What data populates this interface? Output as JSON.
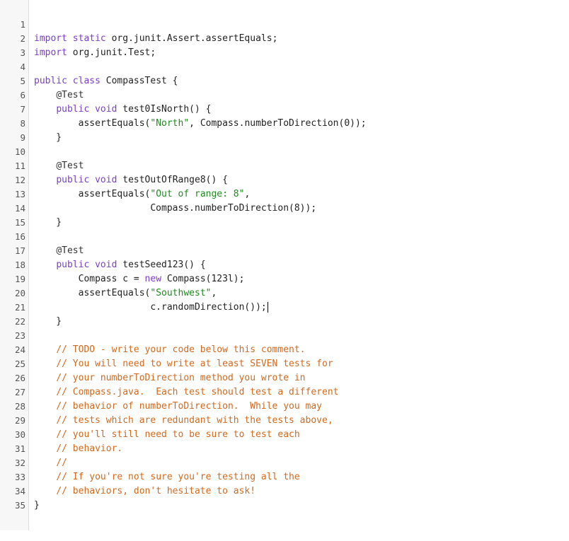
{
  "editor": {
    "line_numbers": [
      "1",
      "2",
      "3",
      "4",
      "5",
      "6",
      "7",
      "8",
      "9",
      "10",
      "11",
      "12",
      "13",
      "14",
      "15",
      "16",
      "17",
      "18",
      "19",
      "20",
      "21",
      "22",
      "23",
      "24",
      "25",
      "26",
      "27",
      "28",
      "29",
      "30",
      "31",
      "32",
      "33",
      "34",
      "35"
    ],
    "lines": [
      [
        "import",
        " ",
        "static",
        " org.junit.Assert.assertEquals;"
      ],
      [
        "import",
        " org.junit.Test;"
      ],
      [
        ""
      ],
      [
        "public",
        " ",
        "class",
        " CompassTest {"
      ],
      [
        "    ",
        "@Test"
      ],
      [
        "    ",
        "public",
        " ",
        "void",
        " test0IsNorth() {"
      ],
      [
        "        assertEquals(",
        "\"North\"",
        ", Compass.numberToDirection(0));"
      ],
      [
        "    }"
      ],
      [
        ""
      ],
      [
        "    ",
        "@Test"
      ],
      [
        "    ",
        "public",
        " ",
        "void",
        " testOutOfRange8() {"
      ],
      [
        "        assertEquals(",
        "\"Out of range: 8\"",
        ","
      ],
      [
        "                     Compass.numberToDirection(8));"
      ],
      [
        "    }"
      ],
      [
        ""
      ],
      [
        "    ",
        "@Test"
      ],
      [
        "    ",
        "public",
        " ",
        "void",
        " testSeed123() {"
      ],
      [
        "        Compass c = ",
        "new",
        " Compass(123l);"
      ],
      [
        "        assertEquals(",
        "\"Southwest\"",
        ","
      ],
      [
        "                     c.randomDirection());"
      ],
      [
        "    }"
      ],
      [
        ""
      ],
      [
        "    ",
        "// TODO - write your code below this comment."
      ],
      [
        "    ",
        "// You will need to write at least SEVEN tests for"
      ],
      [
        "    ",
        "// your numberToDirection method you wrote in"
      ],
      [
        "    ",
        "// Compass.java.  Each test should test a different"
      ],
      [
        "    ",
        "// behavior of numberToDirection.  While you may"
      ],
      [
        "    ",
        "// tests which are redundant with the tests above,"
      ],
      [
        "    ",
        "// you'll still need to be sure to test each"
      ],
      [
        "    ",
        "// behavior."
      ],
      [
        "    ",
        "//"
      ],
      [
        "    ",
        "// If you're not sure you're testing all the"
      ],
      [
        "    ",
        "// behaviors, don't hesitate to ask!"
      ],
      [
        "}"
      ],
      [
        ""
      ]
    ]
  }
}
